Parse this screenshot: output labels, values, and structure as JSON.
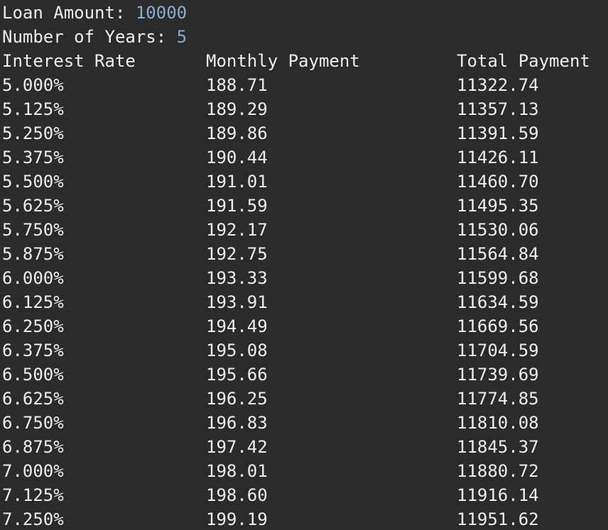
{
  "prompts": {
    "loan_amount_label": "Loan Amount: ",
    "loan_amount_value": "10000",
    "years_label": "Number of Years: ",
    "years_value": "5"
  },
  "table": {
    "headers": [
      "Interest Rate",
      "Monthly Payment",
      "Total Payment"
    ],
    "rows": [
      [
        "5.000%",
        "188.71",
        "11322.74"
      ],
      [
        "5.125%",
        "189.29",
        "11357.13"
      ],
      [
        "5.250%",
        "189.86",
        "11391.59"
      ],
      [
        "5.375%",
        "190.44",
        "11426.11"
      ],
      [
        "5.500%",
        "191.01",
        "11460.70"
      ],
      [
        "5.625%",
        "191.59",
        "11495.35"
      ],
      [
        "5.750%",
        "192.17",
        "11530.06"
      ],
      [
        "5.875%",
        "192.75",
        "11564.84"
      ],
      [
        "6.000%",
        "193.33",
        "11599.68"
      ],
      [
        "6.125%",
        "193.91",
        "11634.59"
      ],
      [
        "6.250%",
        "194.49",
        "11669.56"
      ],
      [
        "6.375%",
        "195.08",
        "11704.59"
      ],
      [
        "6.500%",
        "195.66",
        "11739.69"
      ],
      [
        "6.625%",
        "196.25",
        "11774.85"
      ],
      [
        "6.750%",
        "196.83",
        "11810.08"
      ],
      [
        "6.875%",
        "197.42",
        "11845.37"
      ],
      [
        "7.000%",
        "198.01",
        "11880.72"
      ],
      [
        "7.125%",
        "198.60",
        "11916.14"
      ],
      [
        "7.250%",
        "199.19",
        "11951.62"
      ]
    ]
  },
  "colors": {
    "background": "#2b2b2b",
    "text": "#eeeeee",
    "input_value": "#88aecf"
  }
}
